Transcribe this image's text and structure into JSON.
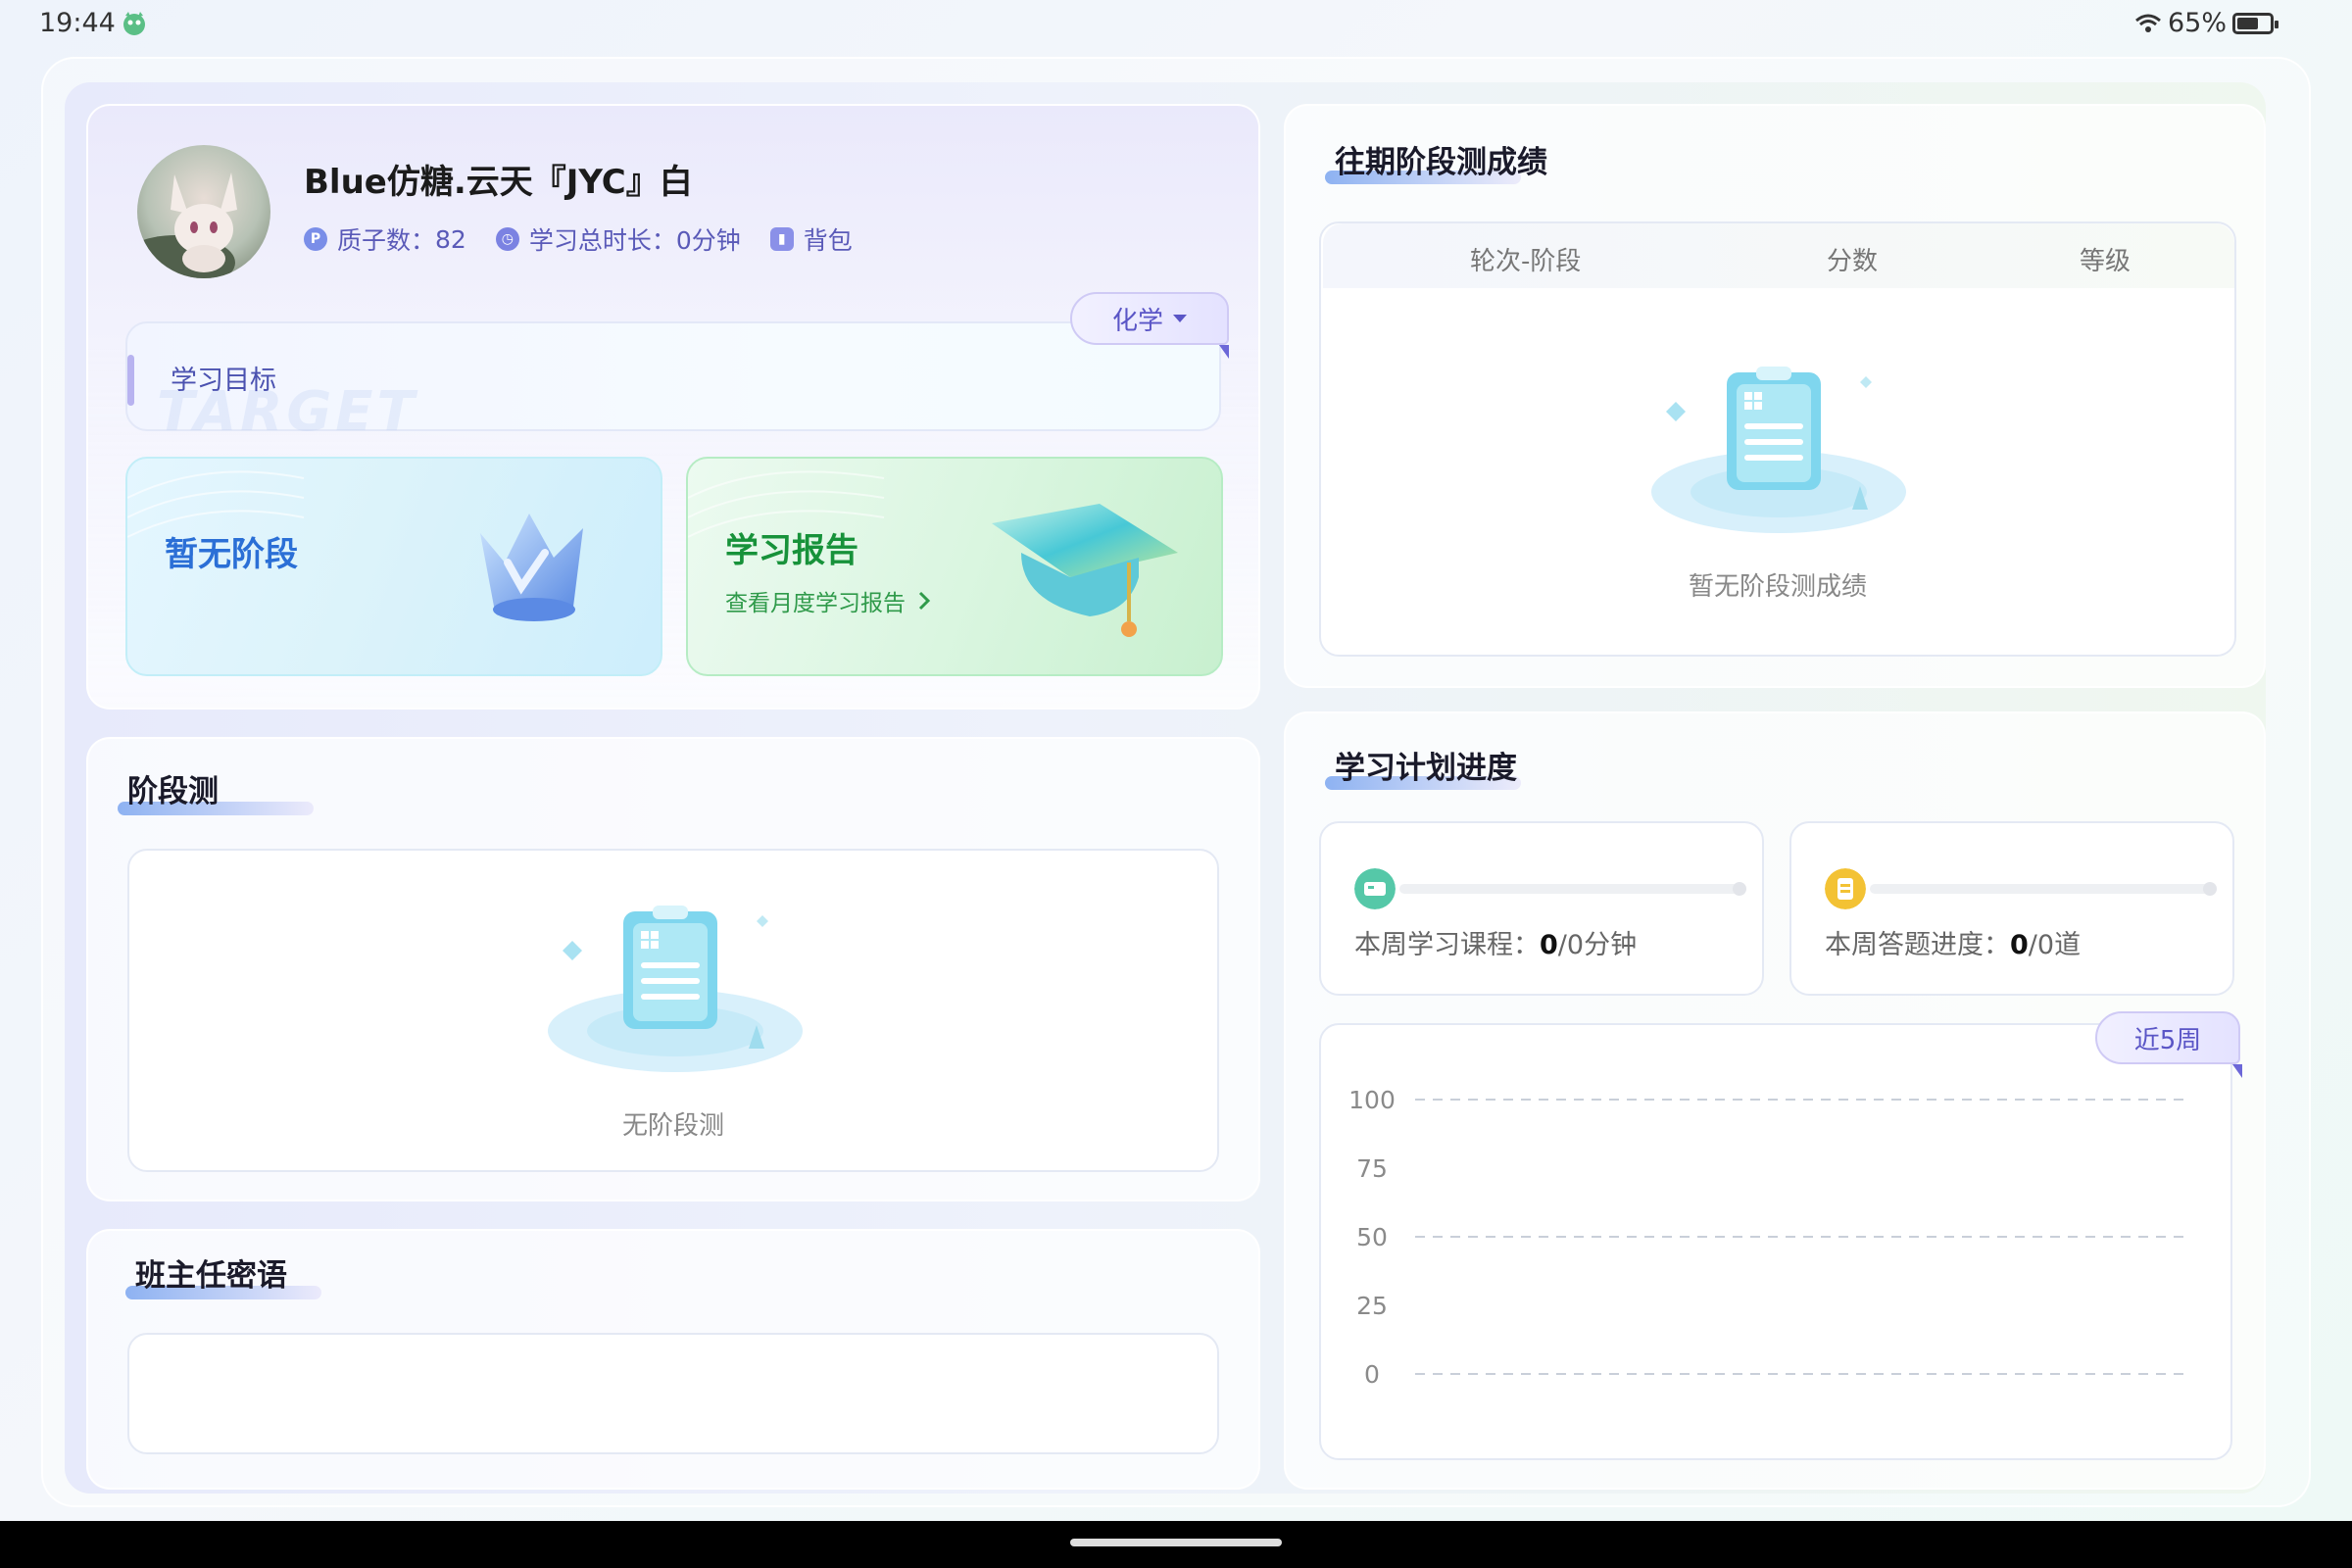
{
  "status_bar": {
    "time": "19:44",
    "battery": "65%",
    "battery_level": 0.65
  },
  "profile": {
    "username": "Blue仿糖.云天『JYC』白",
    "quality_label": "质子数：",
    "quality_value": "82",
    "duration_label": "学习总时长：",
    "duration_value": "0分钟",
    "bag_label": "背包"
  },
  "goal": {
    "label": "学习目标",
    "ghost": "TARGET",
    "subject": "化学"
  },
  "tiles": {
    "stage": {
      "title": "暂无阶段"
    },
    "report": {
      "title": "学习报告",
      "subtitle": "查看月度学习报告"
    }
  },
  "stage_test": {
    "title": "阶段测",
    "empty": "无阶段测"
  },
  "teacher_notes": {
    "title": "班主任密语"
  },
  "past_scores": {
    "title": "往期阶段测成绩",
    "columns": [
      "轮次-阶段",
      "分数",
      "等级"
    ],
    "empty": "暂无阶段测成绩"
  },
  "plan_progress": {
    "title": "学习计划进度",
    "course": {
      "label": "本周学习课程：",
      "done": "0",
      "total": "/0分钟",
      "fraction": 0
    },
    "quiz": {
      "label": "本周答题进度：",
      "done": "0",
      "total": "/0道",
      "fraction": 0
    },
    "range_tab": "近5周"
  },
  "chart_data": {
    "type": "line",
    "y_ticks": [
      "100",
      "75",
      "50",
      "25",
      "0"
    ],
    "ylim": [
      0,
      100
    ],
    "grid_y": [
      100,
      50,
      0
    ],
    "series": []
  },
  "colors": {
    "accent": "#5a55c6",
    "stage_title": "#2b6fd6",
    "report_title": "#17923a"
  }
}
